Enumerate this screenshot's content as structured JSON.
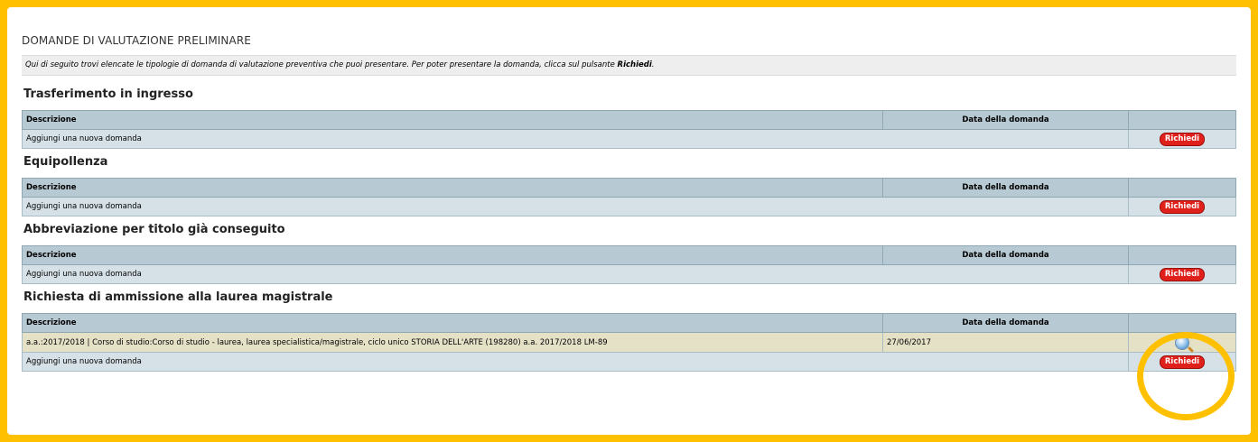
{
  "page_title": "DOMANDE DI VALUTAZIONE PRELIMINARE",
  "info": {
    "text_prefix": "Qui di seguito trovi elencate le tipologie di domanda di valutazione preventiva che puoi presentare. Per poter presentare la domanda, clicca sul pulsante ",
    "text_bold": "Richiedi",
    "text_suffix": "."
  },
  "columns": {
    "descrizione": "Descrizione",
    "data": "Data della domanda"
  },
  "add_label": "Aggiungi una nuova domanda",
  "richiedi_label": "Richiedi",
  "sections": [
    {
      "title": "Trasferimento in ingresso"
    },
    {
      "title": "Equipollenza"
    },
    {
      "title": "Abbreviazione per titolo già conseguito"
    },
    {
      "title": "Richiesta di ammissione alla laurea magistrale",
      "records": [
        {
          "descrizione": "a.a.:2017/2018 | Corso di studio:Corso di studio - laurea, laurea specialistica/magistrale, ciclo unico STORIA DELL'ARTE (198280) a.a. 2017/2018 LM-89",
          "data": "27/06/2017",
          "icon": "magnifier-icon"
        }
      ]
    }
  ],
  "colors": {
    "border_frame": "#FFC000",
    "header_row": "#B7C9D3",
    "body_row": "#D5E1E7",
    "record_row": "#E5E1C7",
    "button": "#E0201B"
  }
}
